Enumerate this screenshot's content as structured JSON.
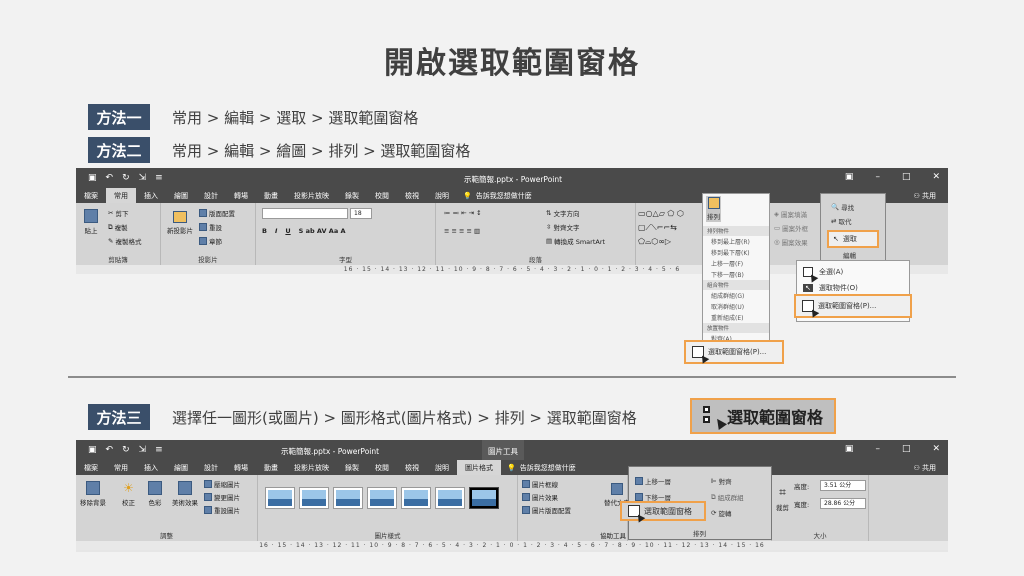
{
  "title": "開啟選取範圍窗格",
  "methods": [
    {
      "badge": "方法一",
      "text": "常用 > 編輯 > 選取 > 選取範圍窗格"
    },
    {
      "badge": "方法二",
      "text": "常用 > 編輯 > 繪圖 > 排列 > 選取範圍窗格"
    },
    {
      "badge": "方法三",
      "text": "選擇任一圖形(或圖片) > 圖形格式(圖片格式) > 排列 > 選取範圍窗格"
    }
  ],
  "big_button_label": "選取範圍窗格",
  "screenshot1": {
    "doc_title": "示範簡報.pptx - PowerPoint",
    "tabs": [
      "檔案",
      "常用",
      "插入",
      "繪圖",
      "設計",
      "轉場",
      "動畫",
      "投影片放映",
      "錄製",
      "校閱",
      "檢視",
      "說明"
    ],
    "active_tab": "常用",
    "tell_me": "告訴我您想做什麼",
    "share": "共用",
    "groups": {
      "clipboard": {
        "label": "剪貼簿",
        "paste": "貼上",
        "cut": "剪下",
        "copy": "複製",
        "format_painter": "複製格式"
      },
      "slides": {
        "label": "投影片",
        "new_slide": "新投影片",
        "layout": "版面配置",
        "reset": "重設",
        "section": "章節"
      },
      "font": {
        "label": "字型",
        "size": "18"
      },
      "paragraph": {
        "label": "段落",
        "text_direction": "文字方向",
        "align_text": "對齊文字",
        "smartart": "轉換成 SmartArt"
      },
      "editing": {
        "label": "編輯",
        "find": "尋找",
        "replace": "取代",
        "select": "選取"
      },
      "shape_fill": "圖案填滿",
      "shape_outline": "圖案外框",
      "shape_effect": "圖案效果"
    },
    "ruler": "16 · 15 · 14 · 13 · 12 · 11 · 10 · 9 · 8 · 7 · 6 · 5 · 4 · 3 · 2 · 1 · 0 · 1 · 2 · 3 · 4 · 5 · 6",
    "arrange_menu": {
      "header1": "排列物件",
      "items1": [
        "移到最上層(R)",
        "移到最下層(K)",
        "上移一層(F)",
        "下移一層(B)"
      ],
      "header2": "組合物件",
      "items2": [
        "組成群組(G)",
        "取消群組(U)",
        "重新組成(E)"
      ],
      "header3": "放置物件",
      "items3": [
        "對齊(A)"
      ],
      "selection_pane": "選取範圍窗格(P)..."
    },
    "select_menu": {
      "select_all": "全選(A)",
      "select_objects": "選取物件(O)",
      "selection_pane": "選取範圍窗格(P)..."
    }
  },
  "screenshot2": {
    "doc_title": "示範簡報.pptx - PowerPoint",
    "context_label": "圖片工具",
    "tabs": [
      "檔案",
      "常用",
      "插入",
      "繪圖",
      "設計",
      "轉場",
      "動畫",
      "投影片放映",
      "錄製",
      "校閱",
      "檢視",
      "說明",
      "圖片格式"
    ],
    "active_tab": "圖片格式",
    "tell_me": "告訴我您想做什麼",
    "share": "共用",
    "adjust": {
      "label": "調整",
      "remove_bg": "移除背景",
      "corrections": "校正",
      "color": "色彩",
      "artistic": "美術效果",
      "compress": "壓縮圖片",
      "change": "變更圖片",
      "reset": "重設圖片"
    },
    "styles": {
      "label": "圖片樣式",
      "border": "圖片框線",
      "effects": "圖片效果",
      "layout": "圖片版面配置"
    },
    "accessibility": "協助工具",
    "alt_text": "替代文字",
    "arrange": {
      "label": "排列",
      "forward": "上移一層",
      "backward": "下移一層",
      "selection_pane": "選取範圍窗格",
      "align": "對齊",
      "group": "組成群組",
      "rotate": "旋轉"
    },
    "size": {
      "label": "大小",
      "height_label": "高度:",
      "height": "3.51 公分",
      "width_label": "寬度:",
      "width": "28.86 公分",
      "crop": "裁剪"
    },
    "ruler": "16 · 15 · 14 · 13 · 12 · 11 · 10 · 9 · 8 · 7 · 6 · 5 · 4 · 3 · 2 · 1 · 0 · 1 · 2 · 3 · 4 · 5 · 6 · 7 · 8 · 9 · 10 · 11 · 12 · 13 · 14 · 15 · 16"
  }
}
